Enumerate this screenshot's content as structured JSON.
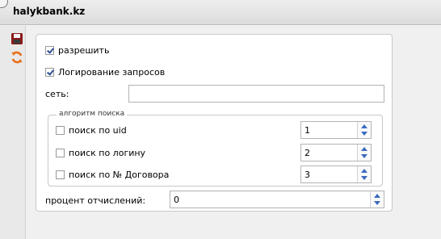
{
  "window": {
    "title": "halykbank.kz"
  },
  "toolbar": {
    "save_icon": "save-icon",
    "refresh_icon": "refresh-icon"
  },
  "form": {
    "allow_label": "разрешить",
    "allow_checked": true,
    "logging_label": "Логирование запросов",
    "logging_checked": true,
    "network_label": "сеть:",
    "network_value": "",
    "search_group": {
      "legend": "алгоритм поиска",
      "items": [
        {
          "label": "поиск по uid",
          "checked": false,
          "value": "1"
        },
        {
          "label": "поиск по логину",
          "checked": false,
          "value": "2"
        },
        {
          "label": "поиск по № Договора",
          "checked": false,
          "value": "3"
        }
      ]
    },
    "deduction_label": "процент отчислений:",
    "deduction_value": "0"
  },
  "colors": {
    "accent_blue": "#2a4f95",
    "save_icon": "#8b1a1a",
    "refresh_icon": "#e8701a",
    "spinner_arrow": "#3c6bbf"
  }
}
